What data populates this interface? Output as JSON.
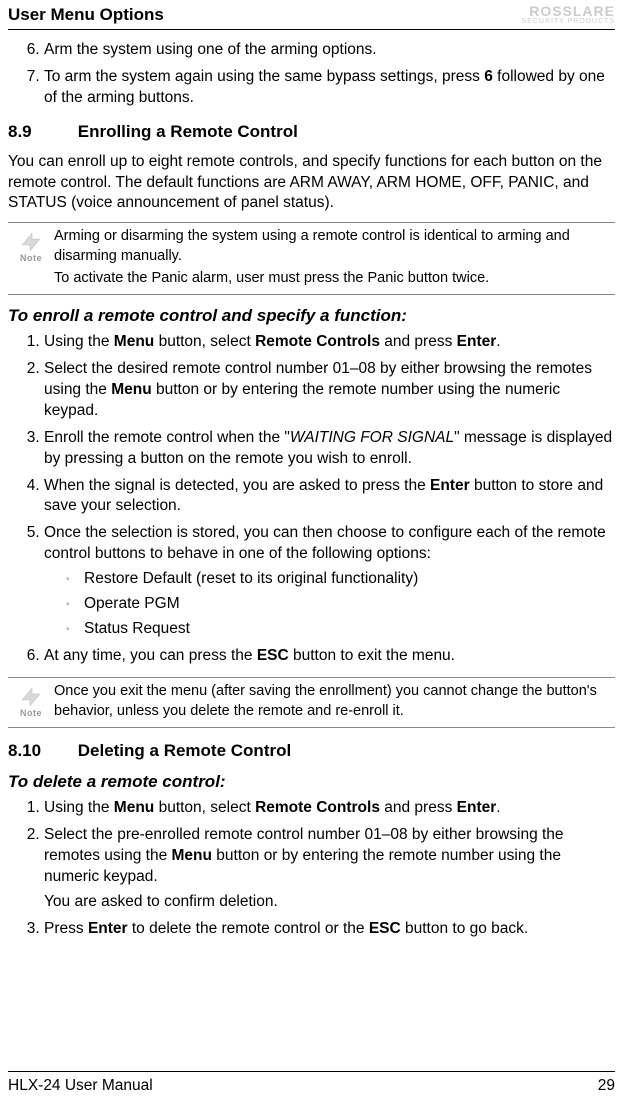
{
  "header": {
    "title": "User Menu Options",
    "brand_top": "ROSSLARE",
    "brand_sub": "SECURITY PRODUCTS"
  },
  "top_list_start": 6,
  "top_list": [
    "Arm the system using one of the arming options.",
    "To arm the system again using the same bypass settings, press 6 followed by one of the arming buttons."
  ],
  "sec_89": {
    "num": "8.9",
    "title": "Enrolling a Remote Control"
  },
  "intro_89": "You can enroll up to eight remote controls, and specify functions for each button on the remote control. The default functions are ARM AWAY, ARM HOME, OFF, PANIC, and STATUS (voice announcement of panel status).",
  "note1": {
    "label": "Note",
    "line1": "Arming or disarming the system using a remote control is identical to arming and disarming manually.",
    "line2": "To activate the Panic alarm, user must press the Panic button twice."
  },
  "sub_enroll": "To enroll a remote control and specify a function:",
  "enroll_steps": {
    "s1": "Using the Menu button, select Remote Controls and press Enter.",
    "s2": "Select the desired remote control number 01–08 by either browsing the remotes using the Menu button or by entering the remote number using the numeric keypad.",
    "s3": "Enroll the remote control when the \"WAITING FOR SIGNAL\" message is displayed by pressing a button on the remote you wish to enroll.",
    "s4": "When the signal is detected, you are asked to press the Enter button to store and save your selection.",
    "s5": "Once the selection is stored, you can then choose to configure each of the remote control buttons to behave in one of the following options:",
    "s6": "At any time, you can press the ESC button to exit the menu."
  },
  "bullets": [
    "Restore Default (reset to its original functionality)",
    "Operate PGM",
    "Status Request"
  ],
  "note2": {
    "label": "Note",
    "text": "Once you exit the menu (after saving the enrollment) you cannot change the button's behavior, unless you delete the remote and re-enroll it."
  },
  "sec_810": {
    "num": "8.10",
    "title": "Deleting a Remote Control"
  },
  "sub_delete": "To delete a remote control:",
  "delete_steps": {
    "s1": "Using the Menu button, select Remote Controls and press Enter.",
    "s2": "Select the pre-enrolled remote control number 01–08 by either browsing the remotes using the Menu button or by entering the remote number using the numeric keypad.",
    "s2b": "You are asked to confirm deletion.",
    "s3": "Press Enter to delete the remote control or the ESC button to go back."
  },
  "footer": {
    "left": "HLX-24 User Manual",
    "right": "29"
  }
}
